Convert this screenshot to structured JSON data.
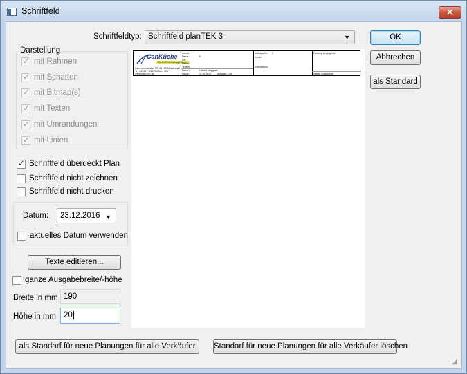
{
  "window": {
    "title": "Schriftfeld",
    "close_label": "✕"
  },
  "schriftfeldtyp": {
    "label": "Schriftfeldtyp:",
    "value": "Schriftfeld planTEK 3"
  },
  "buttons": {
    "ok": "OK",
    "abbrechen": "Abbrechen",
    "als_standard": "als Standard",
    "texte_editieren": "Texte editieren...",
    "standard_neue": "als Standarf für neue Planungen für alle Verkäufer",
    "standard_loeschen": "Standarf für neue Planungen für alle Verkäufer löschen"
  },
  "darstellung": {
    "title": "Darstellung",
    "items": [
      {
        "label": "mit Rahmen",
        "checked": true
      },
      {
        "label": "mit Schatten",
        "checked": true
      },
      {
        "label": "mit Bitmap(s)",
        "checked": true
      },
      {
        "label": "mit Texten",
        "checked": true
      },
      {
        "label": "mit Umrandungen",
        "checked": true
      },
      {
        "label": "mit Linien",
        "checked": true
      }
    ]
  },
  "options": {
    "ueberdeckt": {
      "label": "Schriftfeld überdeckt Plan",
      "checked": true
    },
    "nicht_zeichnen": {
      "label": "Schriftfeld nicht zeichnen",
      "checked": false
    },
    "nicht_drucken": {
      "label": "Schriftfeld nicht drucken",
      "checked": false
    }
  },
  "datum": {
    "label": "Datum:",
    "value": "23.12.2016",
    "aktuelles": {
      "label": "aktuelles Datum verwenden",
      "checked": false
    }
  },
  "ausgabe": {
    "label": "ganze Ausgabebreite/-höhe",
    "checked": false
  },
  "breite": {
    "label": "Breite in mm",
    "value": "190"
  },
  "hoehe": {
    "label": "Höhe in mm",
    "value": "20"
  },
  "preview": {
    "logo_main": "CanKüche",
    "logo_sub": "Studio Einrichtungsplanung",
    "col1": [
      "Kaiserbuchstraße 775 45 / 21 Musterstadt",
      "Tel. 04321 / 1222244 Dext 400",
      "info@planTEK.de"
    ],
    "col2": [
      "Kunde",
      "Name:",
      "Ort:",
      "Datum:",
      "Telefon:",
      "Name Ir.",
      "Datum"
    ],
    "col2b": [
      "0",
      "",
      "",
      "",
      "Liebert Burggeek",
      "11.03.2017",
      "Maßstab:  1:50"
    ],
    "col3": [
      "Auftrags-Nr.:",
      "Kunde:",
      "Kommission:"
    ],
    "col3b": [
      "0"
    ],
    "col4": [
      "Planung freigegeben",
      "Datum   Unterschrift"
    ]
  },
  "colors": {
    "accent": "#3c7fb1",
    "close": "#c75a43",
    "logo": "#1d3a8c"
  }
}
